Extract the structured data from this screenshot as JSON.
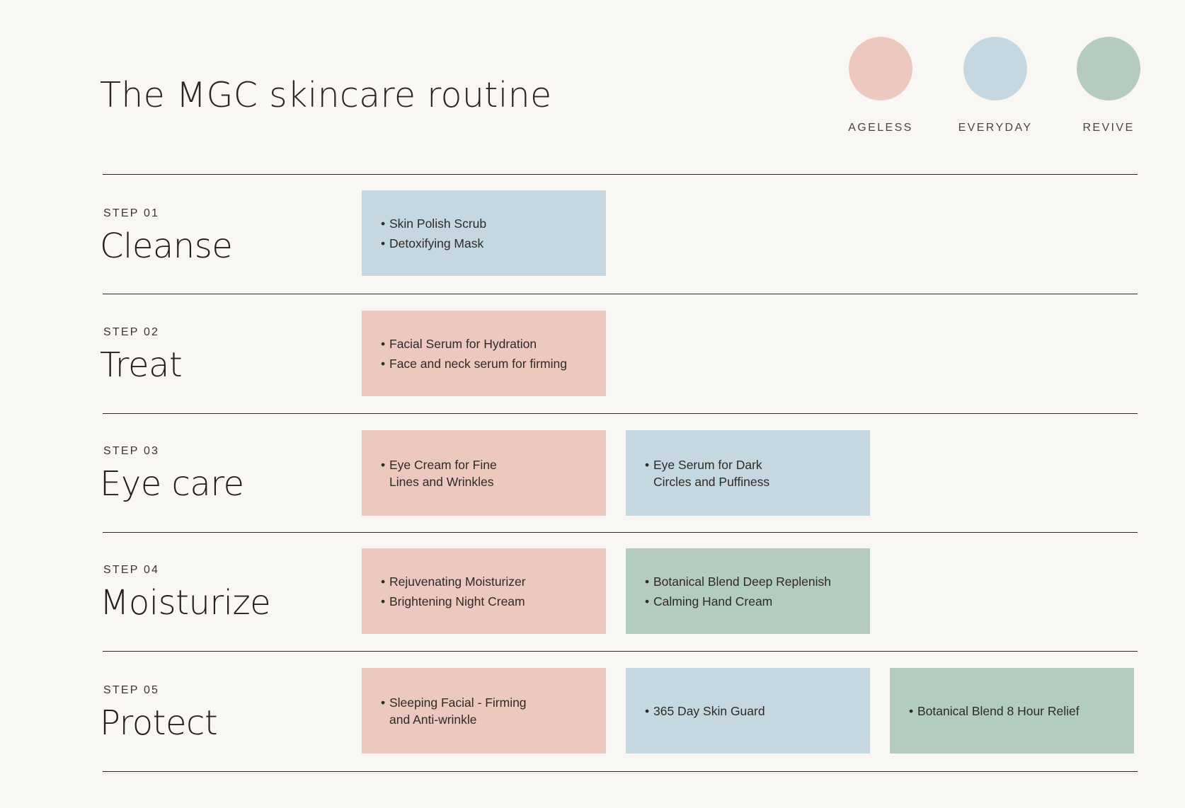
{
  "title": "The MGC skincare routine",
  "colors": {
    "ageless": "#ecc8bf",
    "everyday": "#c5d8e1",
    "revive": "#b4cbc0",
    "background": "#f8f7f4",
    "rule": "#2b2623"
  },
  "legend": [
    {
      "label": "AGELESS",
      "color": "#ecc8bf"
    },
    {
      "label": "EVERYDAY",
      "color": "#c5d8e1"
    },
    {
      "label": "REVIVE",
      "color": "#b4cbc0"
    }
  ],
  "steps": [
    {
      "label": "STEP 01",
      "name": "Cleanse",
      "cards": [
        {
          "line": "everyday",
          "color": "#c5d8e1",
          "items": [
            "Skin Polish Scrub",
            "Detoxifying Mask"
          ]
        }
      ]
    },
    {
      "label": "STEP 02",
      "name": "Treat",
      "cards": [
        {
          "line": "ageless",
          "color": "#ecc8bf",
          "items": [
            "Facial Serum for Hydration",
            "Face and neck serum for firming"
          ]
        }
      ]
    },
    {
      "label": "STEP 03",
      "name": "Eye care",
      "cards": [
        {
          "line": "ageless",
          "color": "#ecc8bf",
          "items": [
            "Eye Cream for Fine\nLines and Wrinkles"
          ]
        },
        {
          "line": "everyday",
          "color": "#c5d8e1",
          "items": [
            "Eye Serum for Dark\nCircles and Puffiness"
          ]
        }
      ]
    },
    {
      "label": "STEP 04",
      "name": "Moisturize",
      "cards": [
        {
          "line": "ageless",
          "color": "#ecc8bf",
          "items": [
            "Rejuvenating Moisturizer",
            "Brightening Night Cream"
          ]
        },
        {
          "line": "revive",
          "color": "#b4cbc0",
          "items": [
            "Botanical Blend Deep Replenish",
            "Calming Hand Cream"
          ]
        }
      ]
    },
    {
      "label": "STEP 05",
      "name": "Protect",
      "cards": [
        {
          "line": "ageless",
          "color": "#ecc8bf",
          "items": [
            "Sleeping Facial - Firming\nand Anti-wrinkle"
          ]
        },
        {
          "line": "everyday",
          "color": "#c5d8e1",
          "items": [
            "365 Day Skin Guard"
          ]
        },
        {
          "line": "revive",
          "color": "#b4cbc0",
          "items": [
            "Botanical Blend 8 Hour Relief"
          ]
        }
      ]
    }
  ]
}
